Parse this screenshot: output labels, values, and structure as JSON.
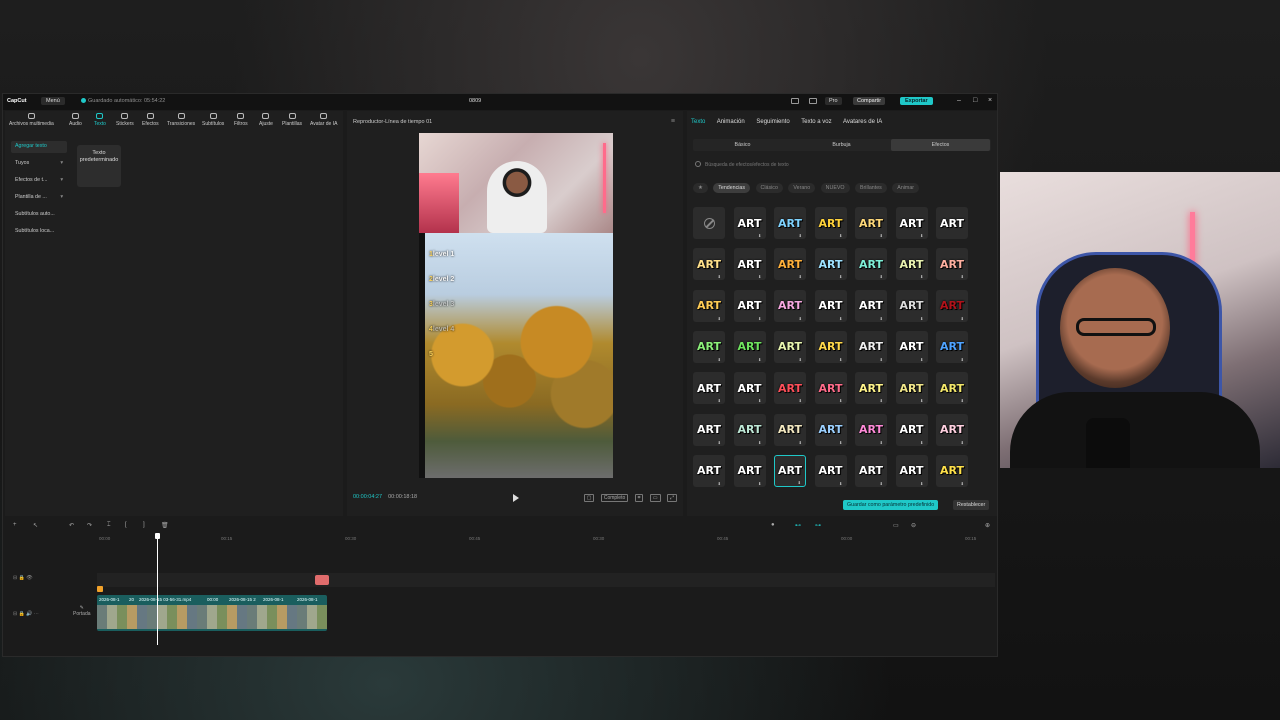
{
  "titlebar": {
    "logo": "CapCut",
    "menu": "Menú",
    "autosave": "Guardado automático: 05:54:22",
    "project": "0809",
    "pro": "Pro",
    "share": "Compartir",
    "export": "Exportar"
  },
  "tools": [
    {
      "label": "Archivos multimedia",
      "icon": "media-icon"
    },
    {
      "label": "Audio",
      "icon": "audio-icon"
    },
    {
      "label": "Texto",
      "icon": "text-icon"
    },
    {
      "label": "Stickers",
      "icon": "sticker-icon"
    },
    {
      "label": "Efectos",
      "icon": "effects-icon"
    },
    {
      "label": "Transiciones",
      "icon": "transition-icon"
    },
    {
      "label": "Subtítulos",
      "icon": "subtitle-icon"
    },
    {
      "label": "Filtros",
      "icon": "filter-icon"
    },
    {
      "label": "Ajuste",
      "icon": "adjust-icon"
    },
    {
      "label": "Plantillas",
      "icon": "template-icon"
    },
    {
      "label": "Avatar de IA",
      "icon": "avatar-icon"
    }
  ],
  "sidebar": {
    "items": [
      {
        "label": "Agregar texto"
      },
      {
        "label": "Tuyos"
      },
      {
        "label": "Efectos de t..."
      },
      {
        "label": "Plantilla de ..."
      },
      {
        "label": "Subtítulos auto..."
      },
      {
        "label": "Subtítulos loca..."
      }
    ]
  },
  "default_text_tile": "Texto predeterminado",
  "player": {
    "title": "Reproductor-Línea de tiempo 01",
    "current_time": "00:00:04:27",
    "total_time": "00:00:18:18",
    "compare": "Completo",
    "levels": [
      {
        "num": "1",
        "text": "level 1"
      },
      {
        "num": "2",
        "text": "level 2"
      },
      {
        "num": "3",
        "text": "level 3"
      },
      {
        "num": "4",
        "text": "level 4"
      },
      {
        "num": "5",
        "text": ""
      }
    ]
  },
  "props": {
    "tabs": [
      "Texto",
      "Animación",
      "Seguimiento",
      "Texto a voz",
      "Avatares de IA"
    ],
    "subtabs": [
      "Básico",
      "Burbuja",
      "Efectos"
    ],
    "search_placeholder": "Búsqueda de efectos/efectos de texto",
    "chips": [
      "Tendencias",
      "Clásico",
      "Verano",
      "NUEVO",
      "Brillantes",
      "Animar"
    ],
    "grid_label": "ART",
    "save_default": "Guardar como parámetro predefinido",
    "reset": "Restablecer"
  },
  "timeline": {
    "ruler": [
      "00:00",
      "00:15",
      "00:30",
      "00:45",
      "00:30",
      "00:45",
      "00:00",
      "00:15"
    ],
    "cover": "Portada",
    "clips": [
      "2026-08-1",
      "20",
      "2026-08-15 03-56-31.mp4",
      "00:00",
      "2026-08-15 2",
      "2026-08-1",
      "2026-08-1"
    ]
  },
  "colors": {
    "accent": "#1fc8c8",
    "selected_clip": "#e06c6c"
  }
}
